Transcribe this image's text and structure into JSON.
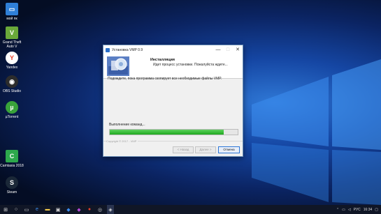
{
  "desktop": {
    "icons": [
      {
        "label": "мой пк",
        "icon": "computer-icon",
        "color": "#2f7fd8"
      },
      {
        "label": "Grand Theft Auto V",
        "icon": "gta-icon",
        "color": "#6aa83a"
      },
      {
        "label": "Yandex",
        "icon": "yandex-icon",
        "color": "#e8402b"
      },
      {
        "label": "OBS Studio",
        "icon": "obs-icon",
        "color": "#2c2c2c"
      },
      {
        "label": "µTorrent",
        "icon": "utorrent-icon",
        "color": "#39a33a"
      },
      {
        "label": "Camtasia 2018",
        "icon": "camtasia-icon",
        "color": "#2da84c"
      },
      {
        "label": "Steam",
        "icon": "steam-icon",
        "color": "#1b2838"
      }
    ]
  },
  "dialog": {
    "title": "Установка VMP 0.9",
    "header_title": "Инсталляция",
    "header_subtitle": "Идет процесс установки. Пожалуйста ждите...",
    "body_text": "Подождите, пока программа скопирует все необходимые файлы VMP.",
    "status_label": "Выполнение команд...",
    "progress": 0.89,
    "copyright": "Copyright © 2017 - VMP",
    "buttons": {
      "back": "< Назад",
      "next": "Далее >",
      "cancel": "Отмена"
    },
    "window_controls": {
      "minimize": "—",
      "maximize": "□",
      "close": "✕"
    }
  },
  "taskbar": {
    "icons": [
      "windows-start-icon",
      "search-icon",
      "task-view-icon",
      "edge-icon",
      "explorer-icon",
      "store-icon",
      "app-icon",
      "app-icon-2",
      "app-icon-3",
      "app-icon-4",
      "installer-icon"
    ],
    "language": "РУС",
    "time": "16:34"
  },
  "colors": {
    "accent": "#2b75d6",
    "progress": "#1fa81f"
  }
}
